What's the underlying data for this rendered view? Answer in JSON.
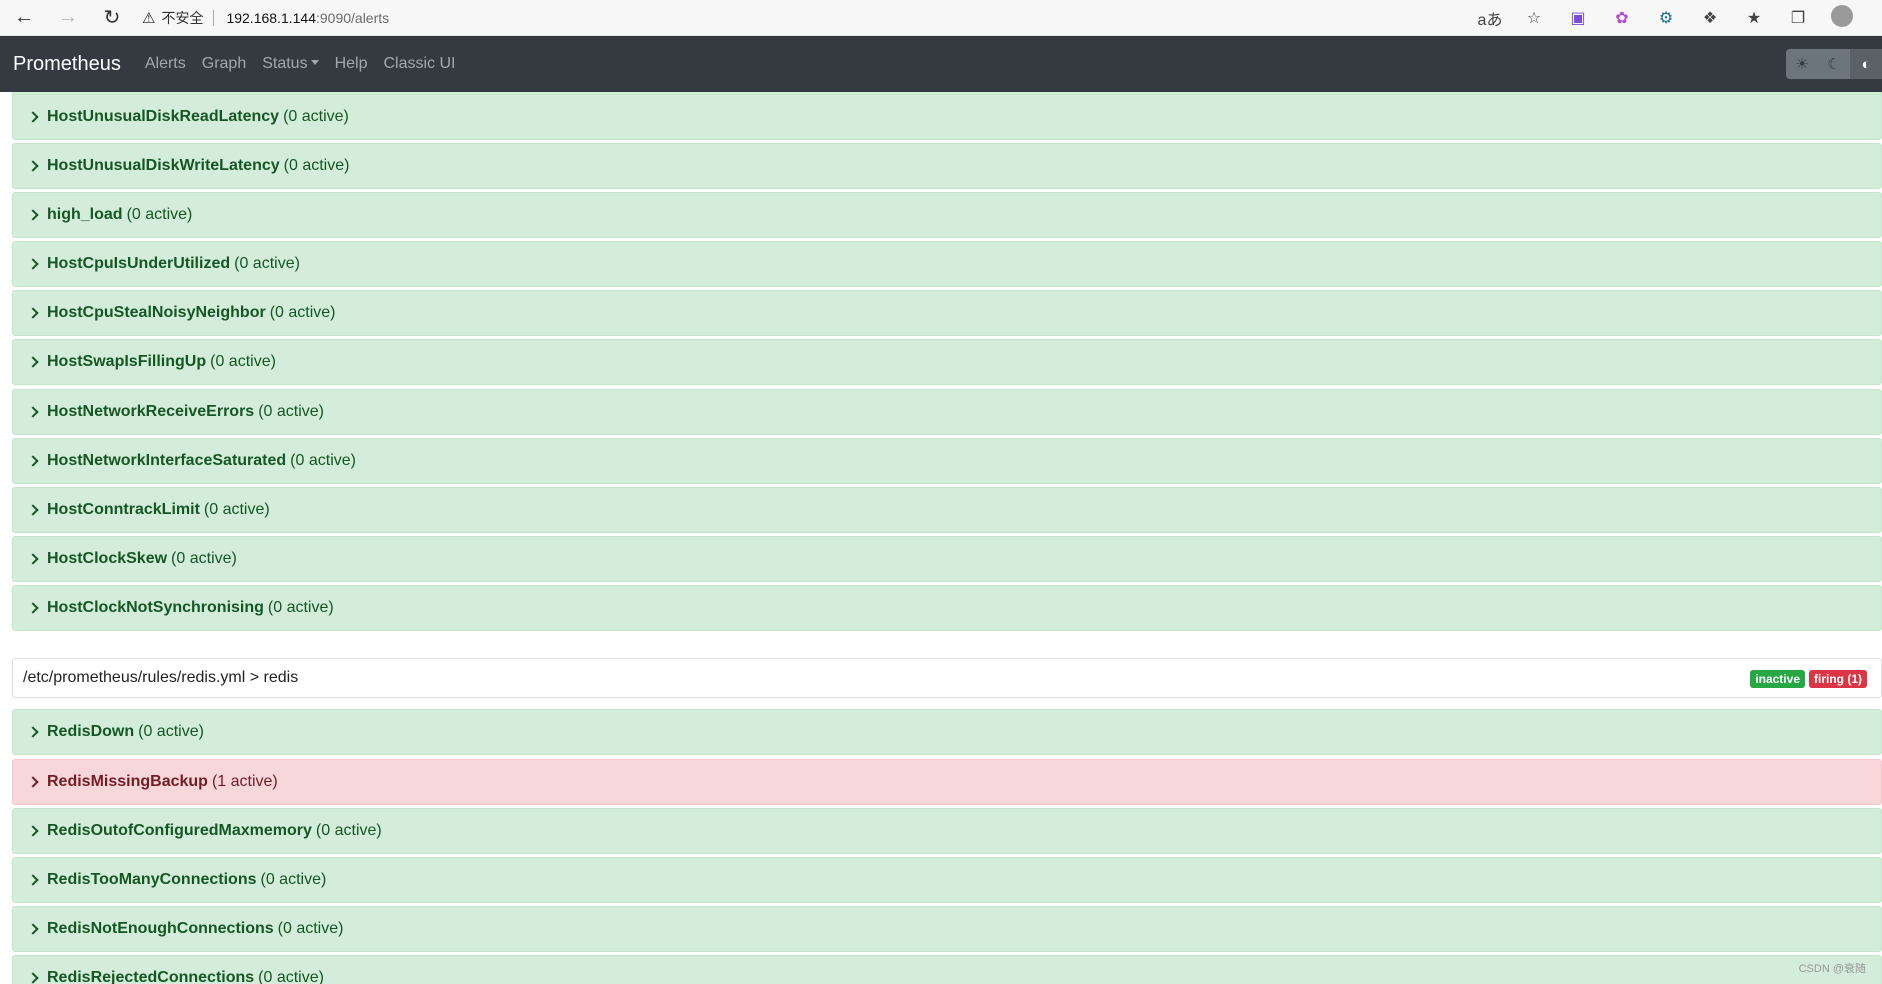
{
  "browser": {
    "security_label": "不安全",
    "url_host": "192.168.1.144",
    "url_path": ":9090/alerts"
  },
  "navbar": {
    "brand": "Prometheus",
    "links": [
      "Alerts",
      "Graph",
      "Status",
      "Help",
      "Classic UI"
    ]
  },
  "rules": [
    {
      "name": "HostUnusualDiskReadLatency",
      "status": "(0 active)",
      "state": "inactive"
    },
    {
      "name": "HostUnusualDiskWriteLatency",
      "status": "(0 active)",
      "state": "inactive"
    },
    {
      "name": "high_load",
      "status": "(0 active)",
      "state": "inactive"
    },
    {
      "name": "HostCpuIsUnderUtilized",
      "status": "(0 active)",
      "state": "inactive"
    },
    {
      "name": "HostCpuStealNoisyNeighbor",
      "status": "(0 active)",
      "state": "inactive"
    },
    {
      "name": "HostSwapIsFillingUp",
      "status": "(0 active)",
      "state": "inactive"
    },
    {
      "name": "HostNetworkReceiveErrors",
      "status": "(0 active)",
      "state": "inactive"
    },
    {
      "name": "HostNetworkInterfaceSaturated",
      "status": "(0 active)",
      "state": "inactive"
    },
    {
      "name": "HostConntrackLimit",
      "status": "(0 active)",
      "state": "inactive"
    },
    {
      "name": "HostClockSkew",
      "status": "(0 active)",
      "state": "inactive"
    },
    {
      "name": "HostClockNotSynchronising",
      "status": "(0 active)",
      "state": "inactive"
    }
  ],
  "group": {
    "title": "/etc/prometheus/rules/redis.yml > redis",
    "badge_inactive": "inactive",
    "badge_firing": "firing (1)"
  },
  "redis_rules": [
    {
      "name": "RedisDown",
      "status": "(0 active)",
      "state": "inactive"
    },
    {
      "name": "RedisMissingBackup",
      "status": "(1 active)",
      "state": "firing"
    },
    {
      "name": "RedisOutofConfiguredMaxmemory",
      "status": "(0 active)",
      "state": "inactive"
    },
    {
      "name": "RedisTooManyConnections",
      "status": "(0 active)",
      "state": "inactive"
    },
    {
      "name": "RedisNotEnoughConnections",
      "status": "(0 active)",
      "state": "inactive"
    },
    {
      "name": "RedisRejectedConnections",
      "status": "(0 active)",
      "state": "inactive"
    }
  ],
  "watermark": "CSDN @衰随"
}
